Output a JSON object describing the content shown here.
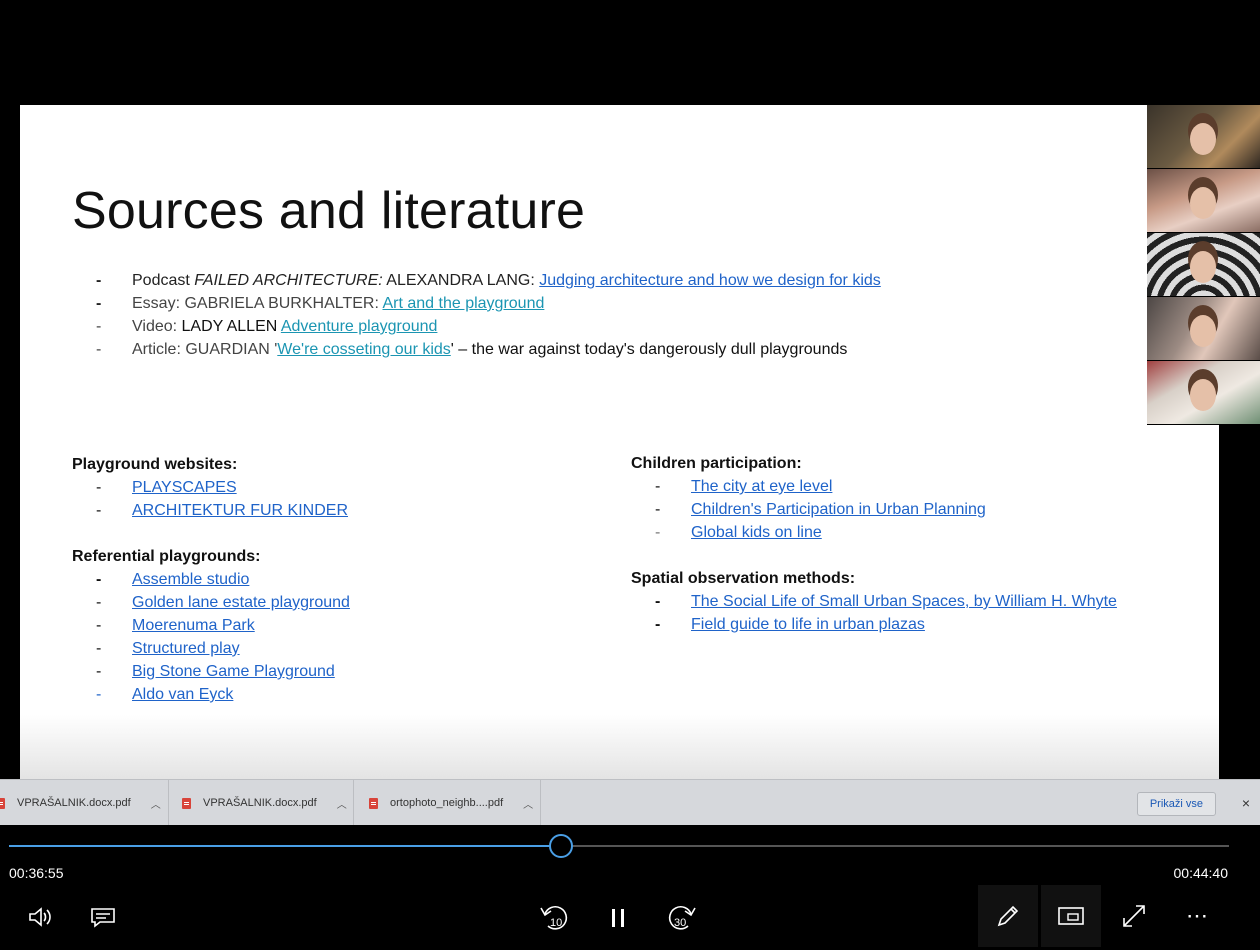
{
  "slide": {
    "title": "Sources and literature",
    "sources": [
      {
        "prefix": "Podcast ",
        "italic": "FAILED ARCHITECTURE:",
        "author": " ALEXANDRA LANG: ",
        "link": "Judging architecture and how we design for kids",
        "suffix": ""
      },
      {
        "prefix": "Essay: ",
        "italic": "",
        "author": "GABRIELA BURKHALTER: ",
        "link": "Art and the playground",
        "suffix": ""
      },
      {
        "prefix": "Video: ",
        "italic": "",
        "author": "LADY ALLEN ",
        "link": "Adventure playground",
        "suffix": ""
      },
      {
        "prefix": "Article: ",
        "italic": "",
        "author": "GUARDIAN '",
        "link": "We're cosseting our kids",
        "suffix": "' – the war against today's dangerously dull playgrounds"
      }
    ],
    "left_col": {
      "websites_heading": "Playground websites:",
      "websites": [
        "PLAYSCAPES",
        "ARCHITEKTUR FUR KINDER"
      ],
      "referential_heading": "Referential playgrounds:",
      "referential": [
        "Assemble studio",
        "Golden lane estate playground",
        "Moerenuma Park",
        "Structured play",
        "Big Stone Game Playground",
        "Aldo van Eyck"
      ]
    },
    "right_col": {
      "participation_heading": "Children participation:",
      "participation": [
        "The city at eye level",
        "Children's Participation in Urban Planning",
        "Global kids on line"
      ],
      "methods_heading": "Spatial observation methods:",
      "methods": [
        "The Social Life of Small Urban Spaces, by William H. Whyte",
        "Field guide to life in urban plazas"
      ]
    },
    "dash": "-"
  },
  "downloads": {
    "items": [
      "VPRAŠALNIK.docx.pdf",
      "VPRAŠALNIK.docx.pdf",
      "ortophoto_neighb....pdf"
    ],
    "show_all": "Prikaži vse",
    "close": "×"
  },
  "player": {
    "current_time": "00:36:55",
    "total_time": "00:44:40",
    "progress_fraction": 0.4525,
    "skip_back_seconds": "10",
    "skip_forward_seconds": "30",
    "more": "⋯",
    "accent_color": "#4a9fe6"
  },
  "icons": [
    "volume-icon",
    "captions-icon",
    "skip-back-icon",
    "pause-icon",
    "skip-forward-icon",
    "pen-icon",
    "mini-view-icon",
    "fullscreen-icon",
    "more-icon",
    "pdf-icon",
    "chevron-up-icon",
    "close-icon"
  ]
}
